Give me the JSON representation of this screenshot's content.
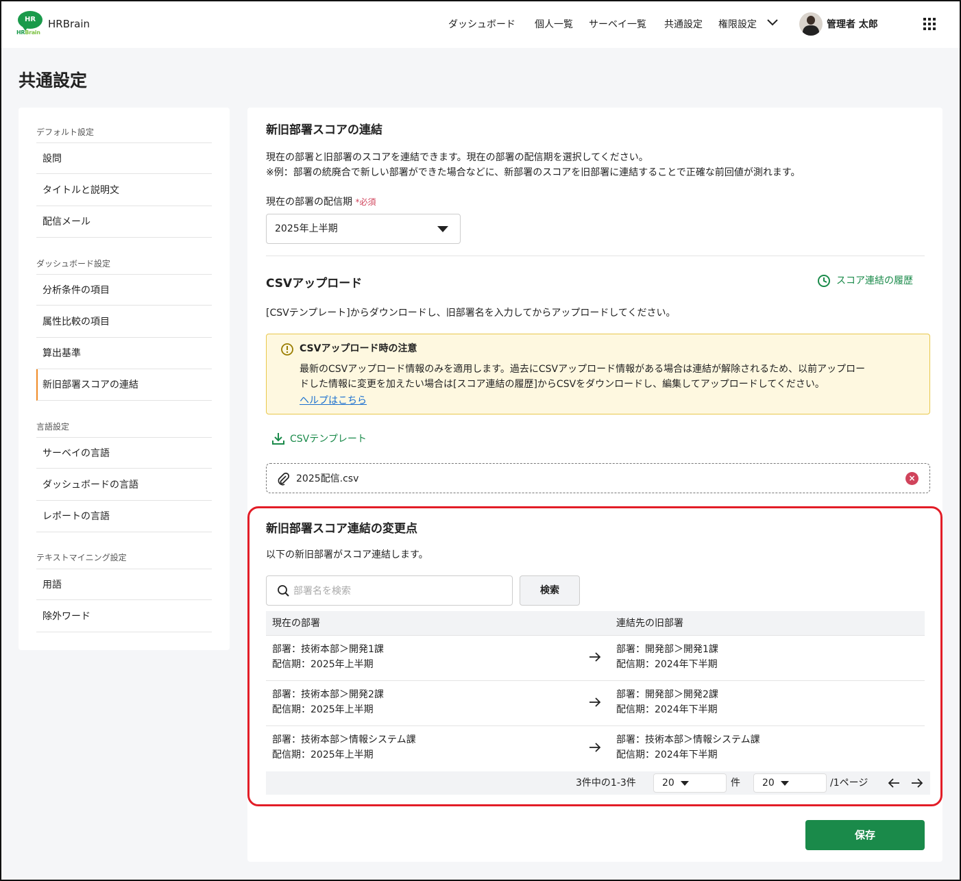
{
  "brand": {
    "name": "HRBrain",
    "logo_top": "HR",
    "logo_bottom_a": "HR",
    "logo_bottom_b": "Brain"
  },
  "nav": {
    "items": [
      "ダッシュボード",
      "個人一覧",
      "サーベイ一覧",
      "共通設定",
      "権限設定"
    ],
    "user_name": "管理者 太郎"
  },
  "page_title": "共通設定",
  "sidebar": {
    "groups": [
      {
        "title": "デフォルト設定",
        "items": [
          "設問",
          "タイトルと説明文",
          "配信メール"
        ]
      },
      {
        "title": "ダッシュボード設定",
        "items": [
          "分析条件の項目",
          "属性比較の項目",
          "算出基準",
          "新旧部署スコアの連結"
        ]
      },
      {
        "title": "言語設定",
        "items": [
          "サーベイの言語",
          "ダッシュボードの言語",
          "レポートの言語"
        ]
      },
      {
        "title": "テキストマイニング設定",
        "items": [
          "用語",
          "除外ワード"
        ]
      }
    ],
    "active_item": "新旧部署スコアの連結"
  },
  "main": {
    "title": "新旧部署スコアの連結",
    "desc1": "現在の部署と旧部署のスコアを連結できます。現在の部署の配信期を選択してください。",
    "desc2": "※例：部署の統廃合で新しい部署ができた場合などに、新部署のスコアを旧部署に連結することで正確な前回値が測れます。",
    "period_label": "現在の部署の配信期",
    "required": "*必須",
    "period_value": "2025年上半期",
    "csv_title": "CSVアップロード",
    "history_link": "スコア連結の履歴",
    "csv_desc": "[CSVテンプレート]からダウンロードし、旧部署名を入力してからアップロードしてください。",
    "notice_title": "CSVアップロード時の注意",
    "notice_line1": "最新のCSVアップロード情報のみを適用します。過去にCSVアップロード情報がある場合は連結が解除されるため、以前アップロー",
    "notice_line2": "ドした情報に変更を加えたい場合は[スコア連結の履歴]からCSVをダウンロードし、編集してアップロードしてください。",
    "help_link": "ヘルプはこちら",
    "template_link": "CSVテンプレート",
    "file_name": "2025配信.csv",
    "changes_title": "新旧部署スコア連結の変更点",
    "changes_desc": "以下の新旧部署がスコア連結します。",
    "search_placeholder": "部署名を検索",
    "search_button": "検索",
    "table": {
      "headers": [
        "現在の部署",
        "連結先の旧部署"
      ],
      "rows": [
        {
          "current_dept": "部署：技術本部＞開発1課",
          "current_period": "配信期：2025年上半期",
          "old_dept": "部署：開発部＞開発1課",
          "old_period": "配信期：2024年下半期"
        },
        {
          "current_dept": "部署：技術本部＞開発2課",
          "current_period": "配信期：2025年上半期",
          "old_dept": "部署：開発部＞開発2課",
          "old_period": "配信期：2024年下半期"
        },
        {
          "current_dept": "部署：技術本部＞情報システム課",
          "current_period": "配信期：2025年上半期",
          "old_dept": "部署：技術本部＞情報システム課",
          "old_period": "配信期：2024年下半期"
        }
      ]
    },
    "pager": {
      "summary": "3件中の1-3件",
      "per_page": "20",
      "per_page_unit": "件",
      "page": "20",
      "page_unit": "/1ページ"
    },
    "save_button": "保存"
  }
}
